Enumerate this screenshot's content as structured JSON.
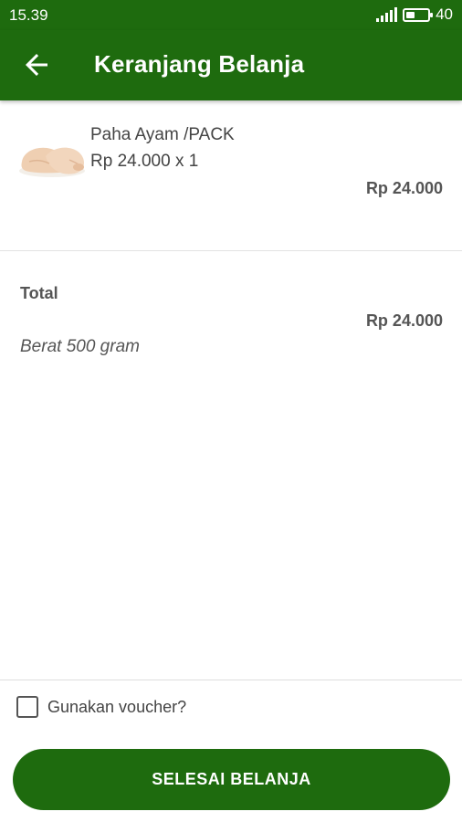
{
  "status_bar": {
    "time": "15.39",
    "battery_level": "40",
    "battery_fraction": 0.4
  },
  "app_bar": {
    "title": "Keranjang Belanja",
    "back_icon": "arrow-left-icon"
  },
  "cart": {
    "items": [
      {
        "name": "Paha Ayam /PACK",
        "price_qty": "Rp 24.000 x 1",
        "subtotal": "Rp 24.000",
        "image_icon": "chicken-thigh-image"
      }
    ]
  },
  "summary": {
    "total_label": "Total",
    "total_amount": "Rp 24.000",
    "weight": "Berat 500 gram"
  },
  "voucher": {
    "label": "Gunakan voucher?",
    "checked": false
  },
  "checkout_button": {
    "label": "SELESAI BELANJA"
  },
  "colors": {
    "primary": "#1e6b0e",
    "background": "#ffffff",
    "text": "#444444"
  }
}
